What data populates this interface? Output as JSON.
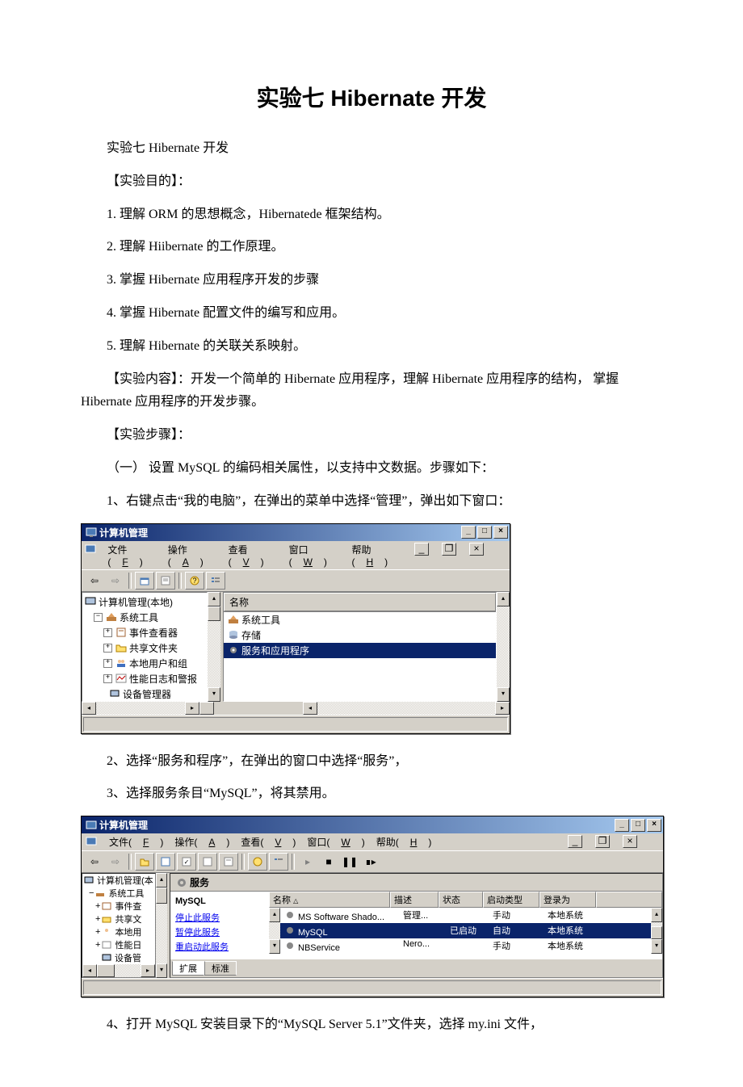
{
  "title": "实验七 Hibernate 开发",
  "p_sub": "实验七 Hibernate 开发",
  "s1_h": "【实验目的】：",
  "s1_1": "1. 理解 ORM 的思想概念，Hibernatede 框架结构。",
  "s1_2": "2. 理解 Hiibernate 的工作原理。",
  "s1_3": "3. 掌握 Hibernate 应用程序开发的步骤",
  "s1_4": "4. 掌握 Hibernate 配置文件的编写和应用。",
  "s1_5": "5. 理解 Hibernate 的关联关系映射。",
  "s2": "【实验内容】：开发一个简单的 Hibernate 应用程序，理解 Hibernate 应用程序的结构， 掌握 Hibernate 应用程序的开发步骤。",
  "s3_h": "【实验步骤】：",
  "s3_1": "（一） 设置 MySQL 的编码相关属性，以支持中文数据。步骤如下：",
  "s3_1_1": "1、右键点击“我的电脑”，在弹出的菜单中选择“管理”，弹出如下窗口：",
  "s3_2": "2、选择“服务和程序”，在弹出的窗口中选择“服务”，",
  "s3_3": "3、选择服务条目“MySQL”，将其禁用。",
  "s3_4": "4、打开 MySQL 安装目录下的“MySQL Server 5.1”文件夹，选择 my.ini 文件，",
  "win1": {
    "title": "计算机管理",
    "menu": {
      "file": "文件(",
      "f": "F",
      "op": "操作(",
      "a": "A",
      "view": "查看(",
      "v": "V",
      "win": "窗口(",
      "w": "W",
      "help": "帮助(",
      "h": "H"
    },
    "tb_min": "_",
    "tb_max": "□",
    "tb_close": "×",
    "tree": {
      "root": "计算机管理(本地)",
      "n1": "系统工具",
      "n1_1": "事件查看器",
      "n1_2": "共享文件夹",
      "n1_3": "本地用户和组",
      "n1_4": "性能日志和警报",
      "n1_5": "设备管理器"
    },
    "list_hdr": "名称",
    "list": [
      "系统工具",
      "存储",
      "服务和应用程序"
    ]
  },
  "win2": {
    "title": "计算机管理",
    "svc_title": "服务",
    "left": {
      "name": "MySQL",
      "l1": "停止此服务",
      "l2": "暂停此服务",
      "l3": "重启动此服务"
    },
    "cols": {
      "name": "名称",
      "desc": "描述",
      "status": "状态",
      "startup": "启动类型",
      "logon": "登录为"
    },
    "rows": [
      {
        "name": "MS Software Shado...",
        "desc": "管理...",
        "status": "",
        "startup": "手动",
        "logon": "本地系统"
      },
      {
        "name": "MySQL",
        "desc": "",
        "status": "已启动",
        "startup": "自动",
        "logon": "本地系统"
      },
      {
        "name": "NBService",
        "desc": "Nero...",
        "status": "",
        "startup": "手动",
        "logon": "本地系统"
      }
    ],
    "tabs": {
      "ext": "扩展",
      "std": "标准"
    },
    "tree": {
      "root": "计算机管理(本",
      "n1": "系统工具",
      "n1_1": "事件查",
      "n1_2": "共享文",
      "n1_3": "本地用",
      "n1_4": "性能日",
      "n1_5": "设备管"
    }
  }
}
